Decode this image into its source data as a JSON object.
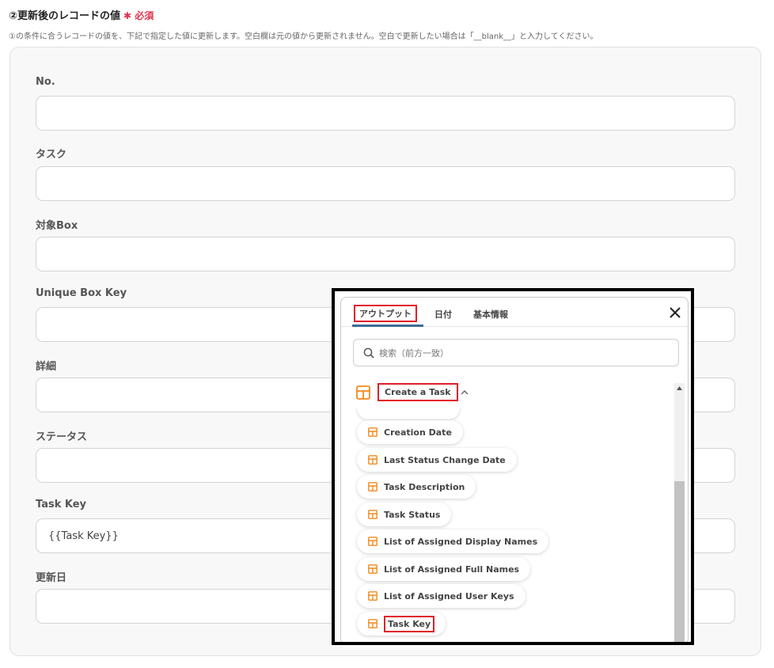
{
  "section": {
    "title": "②更新後のレコードの値",
    "required": "必須",
    "description": "①の条件に合うレコードの値を、下記で指定した値に更新します。空白欄は元の値から更新されません。空白で更新したい場合は「__blank__」と入力してください。"
  },
  "fields": [
    {
      "label": "No.",
      "value": ""
    },
    {
      "label": "タスク",
      "value": ""
    },
    {
      "label": "対象Box",
      "value": ""
    },
    {
      "label": "Unique Box Key",
      "value": ""
    },
    {
      "label": "詳細",
      "value": ""
    },
    {
      "label": "ステータス",
      "value": ""
    },
    {
      "label": "Task Key",
      "value": "{{Task Key}}"
    },
    {
      "label": "更新日",
      "value": ""
    }
  ],
  "popup": {
    "tabs": [
      "アウトプット",
      "日付",
      "基本情報"
    ],
    "search_placeholder": "検索（前方一致）",
    "group_label": "Create a Task",
    "items": [
      "Creation Date",
      "Last Status Change Date",
      "Task Description",
      "Task Status",
      "List of Assigned Display Names",
      "List of Assigned Full Names",
      "List of Assigned User Keys",
      "Task Key"
    ]
  },
  "colors": {
    "required": "#e0334f",
    "highlight": "#e01f2a",
    "icon": "#f08a1c",
    "tab_underline": "#3a6b95"
  }
}
